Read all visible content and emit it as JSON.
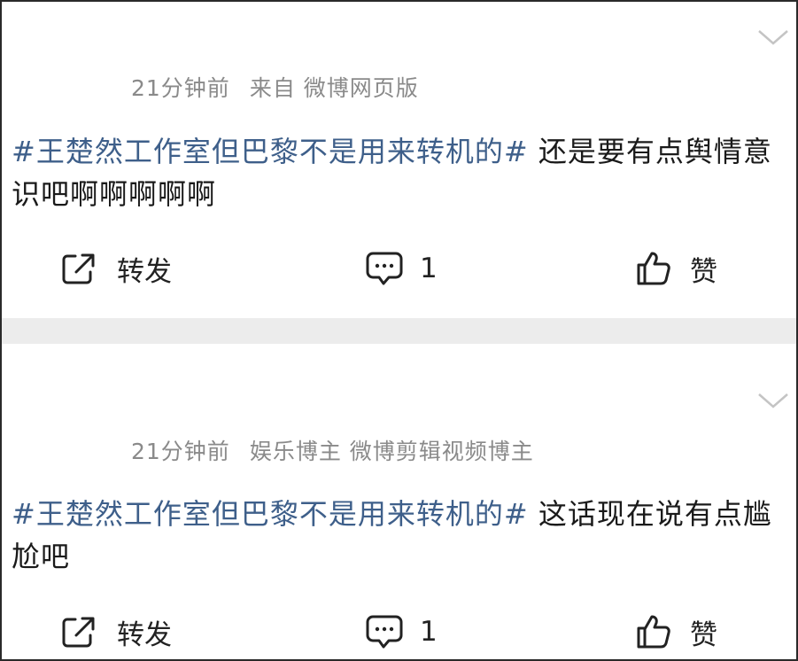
{
  "posts": [
    {
      "time": "21分钟前",
      "source": "来自 微博网页版",
      "topic": "#王楚然工作室但巴黎不是用来转机的#",
      "text": " 还是要有点舆情意识吧啊啊啊啊啊",
      "actions": {
        "repost": "转发",
        "comment_count": "1",
        "like": "赞"
      }
    },
    {
      "time": "21分钟前",
      "source": "娱乐博主 微博剪辑视频博主",
      "topic": "#王楚然工作室但巴黎不是用来转机的#",
      "text": " 这话现在说有点尴尬吧",
      "actions": {
        "repost": "转发",
        "comment_count": "1",
        "like": "赞"
      }
    }
  ],
  "icons": {
    "more": "chevron-down-icon",
    "repost": "share-icon",
    "comment": "comment-icon",
    "like": "thumbs-up-icon"
  },
  "colors": {
    "topic": "#3e5f8a",
    "meta": "#8a8a8a",
    "text": "#1a1a1a",
    "divider": "#ececec"
  }
}
